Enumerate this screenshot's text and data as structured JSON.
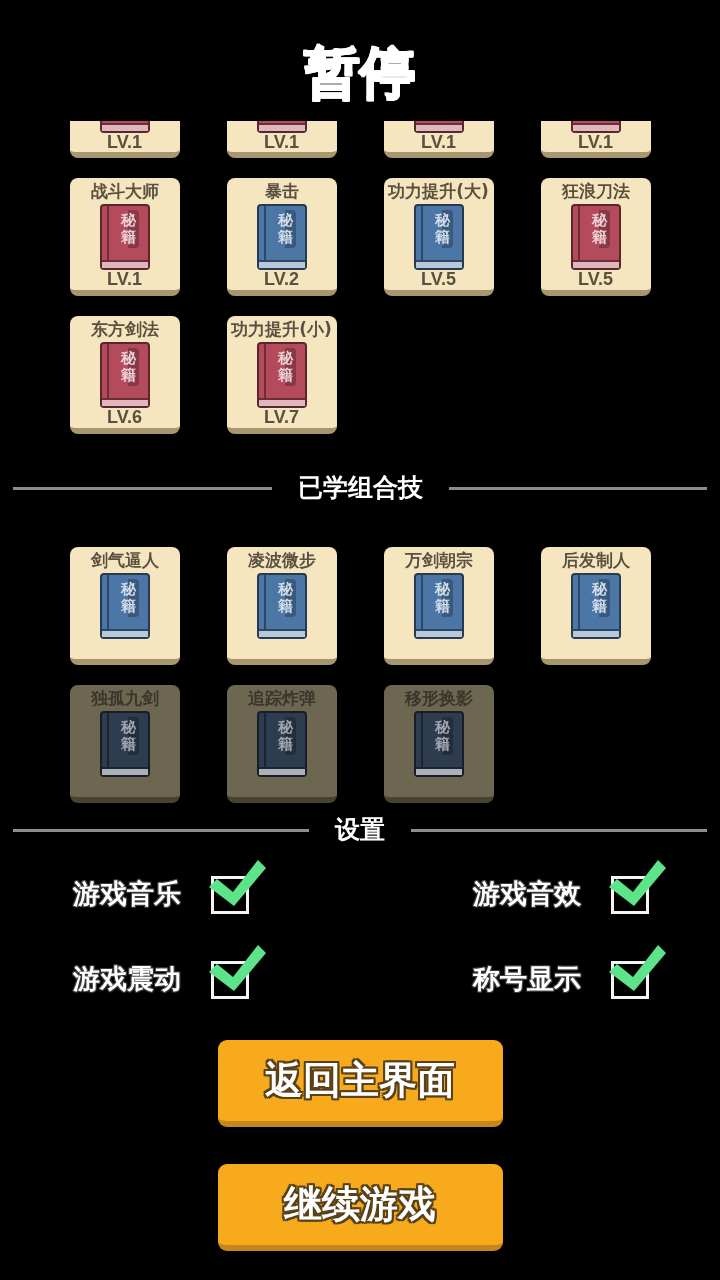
{
  "title": "暂停",
  "skills": [
    {
      "kind": "cut",
      "color": "#b44b5c",
      "grade": "LV.1"
    },
    {
      "kind": "cut",
      "color": "#b44b5c",
      "grade": "LV.1"
    },
    {
      "kind": "cut",
      "color": "#b44b5c",
      "grade": "LV.1"
    },
    {
      "kind": "cut",
      "color": "#b44b5c",
      "grade": "LV.1"
    },
    {
      "kind": "full",
      "title": "战斗大师",
      "book_text": "秘籍",
      "color": "#b44b5c",
      "grade": "LV.1"
    },
    {
      "kind": "full",
      "title": "暴击",
      "book_text": "秘籍",
      "color": "#4b76a6",
      "grade": "LV.2"
    },
    {
      "kind": "full",
      "title": "功力提升(大)",
      "book_text": "秘籍",
      "color": "#4b76a6",
      "grade": "LV.5"
    },
    {
      "kind": "full",
      "title": "狂浪刀法",
      "book_text": "秘籍",
      "color": "#b44b5c",
      "grade": "LV.5"
    },
    {
      "kind": "full",
      "title": "东方剑法",
      "book_text": "秘籍",
      "color": "#b44b5c",
      "grade": "LV.6"
    },
    {
      "kind": "full",
      "title": "功力提升(小)",
      "book_text": "秘籍",
      "color": "#b44b5c",
      "grade": "LV.7"
    }
  ],
  "combos": {
    "heading": "已学组合技",
    "items": [
      {
        "title": "剑气逼人",
        "book_text": "秘籍",
        "color": "#4b76a6",
        "locked": false
      },
      {
        "title": "凌波微步",
        "book_text": "秘籍",
        "color": "#4b76a6",
        "locked": false
      },
      {
        "title": "万剑朝宗",
        "book_text": "秘籍",
        "color": "#4b76a6",
        "locked": false
      },
      {
        "title": "后发制人",
        "book_text": "秘籍",
        "color": "#4b76a6",
        "locked": false
      },
      {
        "title": "独孤九剑",
        "book_text": "秘籍",
        "color": "#2e3c50",
        "locked": true
      },
      {
        "title": "追踪炸弹",
        "book_text": "秘籍",
        "color": "#2e3c50",
        "locked": true
      },
      {
        "title": "移形换影",
        "book_text": "秘籍",
        "color": "#2e3c50",
        "locked": true
      }
    ]
  },
  "settings": {
    "heading": "设置",
    "options": [
      {
        "label": "游戏音乐",
        "checked": true
      },
      {
        "label": "游戏音效",
        "checked": true
      },
      {
        "label": "游戏震动",
        "checked": true
      },
      {
        "label": "称号显示",
        "checked": true
      }
    ]
  },
  "buttons": [
    {
      "label": "返回主界面"
    },
    {
      "label": "继续游戏"
    }
  ]
}
